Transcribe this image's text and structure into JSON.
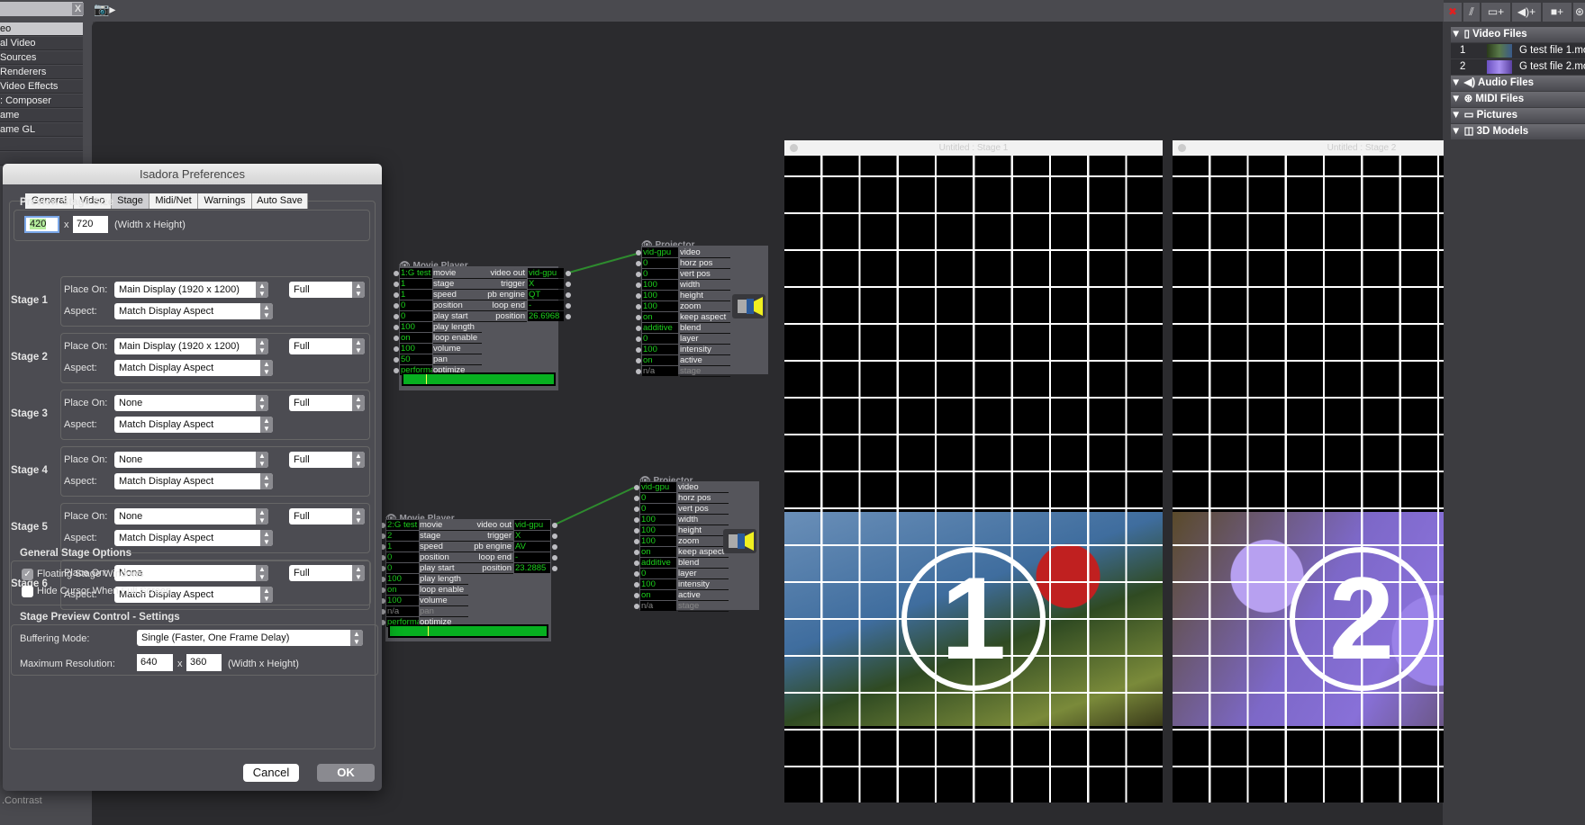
{
  "library": {
    "items": [
      "eo",
      "al Video",
      "Sources",
      "Renderers",
      "Video Effects",
      ": Composer",
      "ame",
      "ame GL",
      "",
      ""
    ],
    "selected_index": 0,
    "clear_label": "X",
    "bottom_item": ".Contrast"
  },
  "toolbar": {
    "snapshot_icon": "camera-icon"
  },
  "preferences": {
    "title": "Isadora Preferences",
    "tabs": [
      "General",
      "Video",
      "Stage",
      "Midi/Net",
      "Warnings",
      "Auto Save"
    ],
    "active_tab": "Stage",
    "preview_size": {
      "label": "Preview Stage Size",
      "width": "420",
      "height": "720",
      "x": "x",
      "hint": "(Width x Height)"
    },
    "place_on_label": "Place On:",
    "aspect_label": "Aspect:",
    "stages": [
      {
        "name": "Stage 1",
        "place_on": "Main Display (1920 x 1200)",
        "mode": "Full",
        "aspect": "Match Display Aspect"
      },
      {
        "name": "Stage 2",
        "place_on": "Main Display (1920 x 1200)",
        "mode": "Full",
        "aspect": "Match Display Aspect"
      },
      {
        "name": "Stage 3",
        "place_on": "None",
        "mode": "Full",
        "aspect": "Match Display Aspect"
      },
      {
        "name": "Stage 4",
        "place_on": "None",
        "mode": "Full",
        "aspect": "Match Display Aspect"
      },
      {
        "name": "Stage 5",
        "place_on": "None",
        "mode": "Full",
        "aspect": "Match Display Aspect"
      },
      {
        "name": "Stage 6",
        "place_on": "None",
        "mode": "Full",
        "aspect": "Match Display Aspect"
      }
    ],
    "general_options": {
      "label": "General Stage Options",
      "floating_windows": {
        "label": "Floating Stage Windows",
        "checked": true
      },
      "hide_cursor": {
        "label": "Hide Cursor When Full Screen",
        "checked": false
      }
    },
    "preview_control": {
      "label": "Stage Preview Control - Settings",
      "buffering_label": "Buffering Mode:",
      "buffering_value": "Single (Faster, One Frame Delay)",
      "max_res_label": "Maximum Resolution:",
      "max_width": "640",
      "max_height": "360",
      "x": "x",
      "hint": "(Width x Height)"
    },
    "cancel_label": "Cancel",
    "ok_label": "OK"
  },
  "nodes": {
    "movie_players": [
      {
        "title": "Movie Player",
        "inputs": [
          [
            "1:G test",
            "movie"
          ],
          [
            "1",
            "stage"
          ],
          [
            "1",
            "speed"
          ],
          [
            "0",
            "position"
          ],
          [
            "0",
            "play start"
          ],
          [
            "100",
            "play length"
          ],
          [
            "on",
            "loop enable"
          ],
          [
            "100",
            "volume"
          ],
          [
            "50",
            "pan"
          ],
          [
            "performa",
            "optimize"
          ]
        ],
        "outputs": [
          [
            "video out",
            "vid-gpu"
          ],
          [
            "trigger",
            "X"
          ],
          [
            "pb engine",
            "QT"
          ],
          [
            "loop end",
            "-"
          ],
          [
            "position",
            "26.6968"
          ]
        ],
        "progress": 0.15
      },
      {
        "title": "Movie Player",
        "inputs": [
          [
            "2:G test",
            "movie"
          ],
          [
            "2",
            "stage"
          ],
          [
            "1",
            "speed"
          ],
          [
            "0",
            "position"
          ],
          [
            "0",
            "play start"
          ],
          [
            "100",
            "play length"
          ],
          [
            "on",
            "loop enable"
          ],
          [
            "100",
            "volume"
          ],
          [
            "n/a",
            "pan"
          ],
          [
            "performa",
            "optimize"
          ]
        ],
        "outputs": [
          [
            "video out",
            "vid-gpu"
          ],
          [
            "trigger",
            "X"
          ],
          [
            "pb engine",
            "AV"
          ],
          [
            "loop end",
            "-"
          ],
          [
            "position",
            "23.2885"
          ]
        ],
        "progress": 0.24
      }
    ],
    "projectors": [
      {
        "title": "Projector",
        "inputs": [
          [
            "vid-gpu",
            "video"
          ],
          [
            "0",
            "horz pos"
          ],
          [
            "0",
            "vert pos"
          ],
          [
            "100",
            "width"
          ],
          [
            "100",
            "height"
          ],
          [
            "100",
            "zoom"
          ],
          [
            "on",
            "keep aspect"
          ],
          [
            "additive",
            "blend"
          ],
          [
            "0",
            "layer"
          ],
          [
            "100",
            "intensity"
          ],
          [
            "on",
            "active"
          ],
          [
            "n/a",
            "stage"
          ]
        ]
      },
      {
        "title": "Projector",
        "inputs": [
          [
            "vid-gpu",
            "video"
          ],
          [
            "0",
            "horz pos"
          ],
          [
            "0",
            "vert pos"
          ],
          [
            "100",
            "width"
          ],
          [
            "100",
            "height"
          ],
          [
            "100",
            "zoom"
          ],
          [
            "on",
            "keep aspect"
          ],
          [
            "additive",
            "blend"
          ],
          [
            "0",
            "layer"
          ],
          [
            "100",
            "intensity"
          ],
          [
            "on",
            "active"
          ],
          [
            "n/a",
            "stage"
          ]
        ]
      }
    ],
    "value_color": "#1cd11c",
    "link_color": "#2e8b2e"
  },
  "stages": [
    {
      "title": "Untitled : Stage 1",
      "number": "1"
    },
    {
      "title": "Untitled : Stage 2",
      "number": "2"
    }
  ],
  "media_panel": {
    "toolbar": [
      "✖",
      "⫽",
      "▭+",
      "◀)+",
      "■+",
      "⊛"
    ],
    "categories": [
      {
        "label": "Video Files",
        "icon": "film-icon",
        "glyph": "▯"
      },
      {
        "label": "Audio Files",
        "icon": "speaker-icon",
        "glyph": "◀)"
      },
      {
        "label": "MIDI Files",
        "icon": "midi-icon",
        "glyph": "⊛"
      },
      {
        "label": "Pictures",
        "icon": "picture-icon",
        "glyph": "▭"
      },
      {
        "label": "3D Models",
        "icon": "cube-icon",
        "glyph": "◫"
      }
    ],
    "video_files": [
      {
        "index": "1",
        "name": "G test file 1.mov"
      },
      {
        "index": "2",
        "name": "G test file 2.mov"
      }
    ]
  }
}
